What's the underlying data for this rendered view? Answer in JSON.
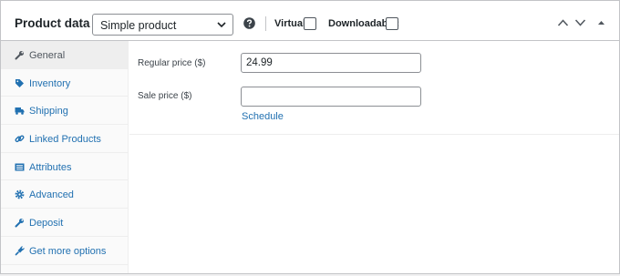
{
  "header": {
    "title": "Product data —",
    "product_type": {
      "selected": "Simple product",
      "options": [
        "Simple product"
      ]
    },
    "virtual_label": "Virtual:",
    "virtual_checked": false,
    "downloadable_label": "Downloadable:",
    "downloadable_checked": false,
    "icons": [
      "help-icon",
      "chevron-up-icon",
      "chevron-down-icon",
      "triangle-up-icon"
    ]
  },
  "sidebar": {
    "items": [
      {
        "label": "General",
        "icon": "wrench-icon",
        "active": true
      },
      {
        "label": "Inventory",
        "icon": "tag-icon",
        "active": false
      },
      {
        "label": "Shipping",
        "icon": "truck-icon",
        "active": false
      },
      {
        "label": "Linked Products",
        "icon": "link-icon",
        "active": false
      },
      {
        "label": "Attributes",
        "icon": "list-icon",
        "active": false
      },
      {
        "label": "Advanced",
        "icon": "gear-icon",
        "active": false
      },
      {
        "label": "Deposit",
        "icon": "wrench-icon",
        "active": false
      },
      {
        "label": "Get more options",
        "icon": "plugin-icon",
        "active": false
      }
    ]
  },
  "general": {
    "regular_price": {
      "label": "Regular price ($)",
      "value": "24.99"
    },
    "sale_price": {
      "label": "Sale price ($)",
      "value": ""
    },
    "schedule_label": "Schedule"
  },
  "colors": {
    "link": "#2271b1",
    "border": "#c3c4c7",
    "active_tab": "#eeeeee",
    "sidebar_bg": "#fafafa"
  }
}
